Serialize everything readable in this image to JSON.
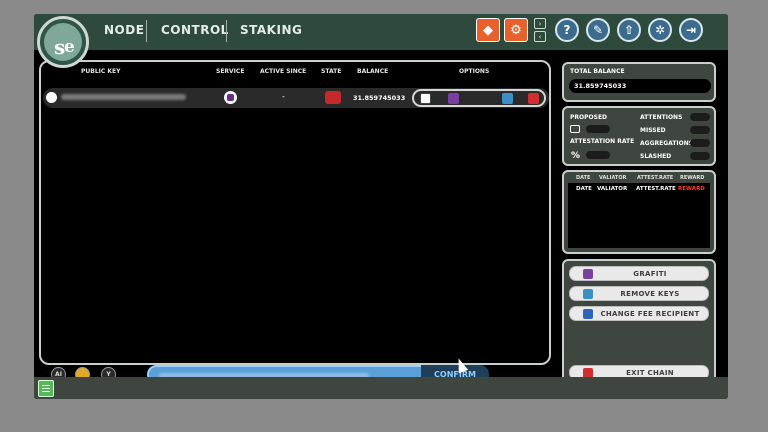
{
  "header": {
    "logo_letter_1": "s",
    "logo_letter_2": "e",
    "nav": [
      {
        "label": "NODE"
      },
      {
        "label": "CONTROL"
      },
      {
        "label": "STAKING"
      }
    ],
    "accent": "#e8612c",
    "square_icons": [
      "grafana-icon",
      "network-icon"
    ],
    "circle_icons": [
      "help-icon",
      "logs-icon",
      "upload-icon",
      "settings-icon",
      "logout-icon"
    ]
  },
  "table": {
    "headers": {
      "public_key": "PUBLIC KEY",
      "service": "SERVICE",
      "active_since": "ACTIVE SINCE",
      "state": "STATE",
      "balance": "BALANCE",
      "options": "OPTIONS"
    },
    "rows": [
      {
        "active_since": "-",
        "balance": "31.859745033",
        "state_color": "#c42a2a",
        "option_icons": [
          "copy-icon",
          "grafiti-icon",
          "remove-key-icon",
          "exit-chain-icon"
        ]
      }
    ]
  },
  "footer": {
    "filter_icons": [
      "AI",
      "folder-icon",
      "filter-icon"
    ],
    "confirm_label": "CONFIRM"
  },
  "balance": {
    "label": "TOTAL BALANCE",
    "value": "31.859745033"
  },
  "stats": {
    "proposed": "PROPOSED",
    "attestation_rate": "ATTESTATION RATE",
    "percent_symbol": "%",
    "attentions": "ATTENTIONS",
    "missed": "MISSED",
    "aggregations": "AGGREGATIONS",
    "slashed": "SLASHED"
  },
  "rewards": {
    "headers": [
      "DATE",
      "VALIATOR",
      "ATTEST.RATE",
      "REWARD"
    ],
    "row": [
      "DATE",
      "VALIATOR",
      "ATTEST.RATE",
      "REWARD"
    ],
    "reward_color": "#ff3b30"
  },
  "actions": {
    "grafiti": "GRAFITI",
    "remove_keys": "REMOVE KEYS",
    "change_fee": "CHANGE FEE RECIPIENT",
    "exit_chain": "EXIT CHAIN"
  }
}
